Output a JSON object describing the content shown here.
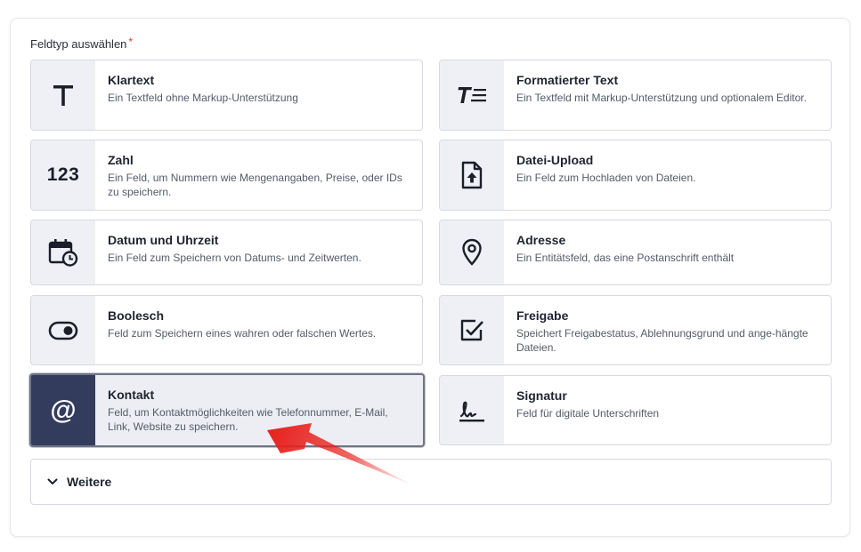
{
  "section": {
    "label": "Feldtyp auswählen",
    "required_mark": "*"
  },
  "cards": [
    {
      "title": "Klartext",
      "desc": "Ein Textfeld ohne Markup-Unterstützung",
      "icon": "text-t-icon"
    },
    {
      "title": "Formatierter Text",
      "desc": "Ein Textfeld mit Markup-Unterstützung und optionalem Editor.",
      "icon": "formatted-text-icon"
    },
    {
      "title": "Zahl",
      "desc": "Ein Feld, um Nummern wie Mengenangaben, Preise, oder IDs zu speichern.",
      "icon": "number-123-icon",
      "icon_text": "123"
    },
    {
      "title": "Datei-Upload",
      "desc": "Ein Feld zum Hochladen von Dateien.",
      "icon": "file-upload-icon"
    },
    {
      "title": "Datum und Uhrzeit",
      "desc": "Ein Feld zum Speichern von Datums- und Zeitwerten.",
      "icon": "calendar-clock-icon"
    },
    {
      "title": "Adresse",
      "desc": "Ein Entitätsfeld, das eine Postanschrift enthält",
      "icon": "location-pin-icon"
    },
    {
      "title": "Boolesch",
      "desc": "Feld zum Speichern eines wahren oder falschen Wertes.",
      "icon": "toggle-icon"
    },
    {
      "title": "Freigabe",
      "desc": "Speichert Freigabestatus, Ablehnungsgrund und ange-hängte Dateien.",
      "icon": "checkbox-icon"
    },
    {
      "title": "Kontakt",
      "desc": "Feld, um Kontaktmöglichkeiten wie Telefonnummer, E-Mail, Link, Website zu speichern.",
      "icon": "at-sign-icon",
      "icon_text": "@",
      "selected": true
    },
    {
      "title": "Signatur",
      "desc": "Feld für digitale Unterschriften",
      "icon": "signature-icon"
    }
  ],
  "more": {
    "label": "Weitere",
    "icon": "chevron-down-icon"
  },
  "colors": {
    "selected_icon_bg": "#343c5e",
    "icon_bg": "#eef0f5",
    "required": "#d9363e",
    "annotation_arrow": "#e8201c"
  }
}
